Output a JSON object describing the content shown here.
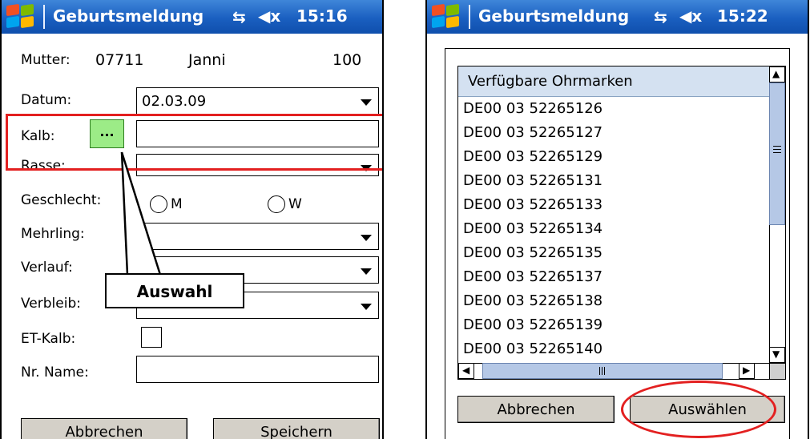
{
  "statusbar": {
    "title": "Geburtsmeldung",
    "connectivity": "⇆",
    "volume": "◀x"
  },
  "left_screen": {
    "time": "15:16",
    "mother": {
      "label": "Mutter:",
      "number": "07711",
      "name": "Janni",
      "value": "100"
    },
    "date": {
      "label": "Datum:",
      "value": "02.03.09"
    },
    "calf": {
      "label": "Kalb:",
      "picker_label": "...",
      "value": ""
    },
    "breed": {
      "label": "Rasse:",
      "value": ""
    },
    "sex": {
      "label": "Geschlecht:",
      "option_m": "M",
      "option_w": "W"
    },
    "multiple": {
      "label": "Mehrling:",
      "value": ""
    },
    "course": {
      "label": "Verlauf:",
      "value": ""
    },
    "whereabouts": {
      "label": "Verbleib:",
      "value": ""
    },
    "et_calf": {
      "label": "ET-Kalb:"
    },
    "name_no": {
      "label": "Nr. Name:",
      "value": ""
    },
    "callout": "Auswahl",
    "cancel_button": "Abbrechen",
    "save_button": "Speichern"
  },
  "right_screen": {
    "time": "15:22",
    "list_header": "Verfügbare Ohrmarken",
    "items": [
      "DE00 03 52265126",
      "DE00 03 52265127",
      "DE00 03 52265129",
      "DE00 03 52265131",
      "DE00 03 52265133",
      "DE00 03 52265134",
      "DE00 03 52265135",
      "DE00 03 52265137",
      "DE00 03 52265138",
      "DE00 03 52265139",
      "DE00 03 52265140"
    ],
    "cancel_button": "Abbrechen",
    "select_button": "Auswählen"
  },
  "icons": {
    "scroll_up": "▲",
    "scroll_down": "▼",
    "scroll_left": "◀",
    "scroll_right": "▶"
  },
  "colors": {
    "titlebar": "#1a5fc0",
    "highlight": "#e32020",
    "picker_button": "#9cec87",
    "list_header": "#d4e1f1"
  }
}
